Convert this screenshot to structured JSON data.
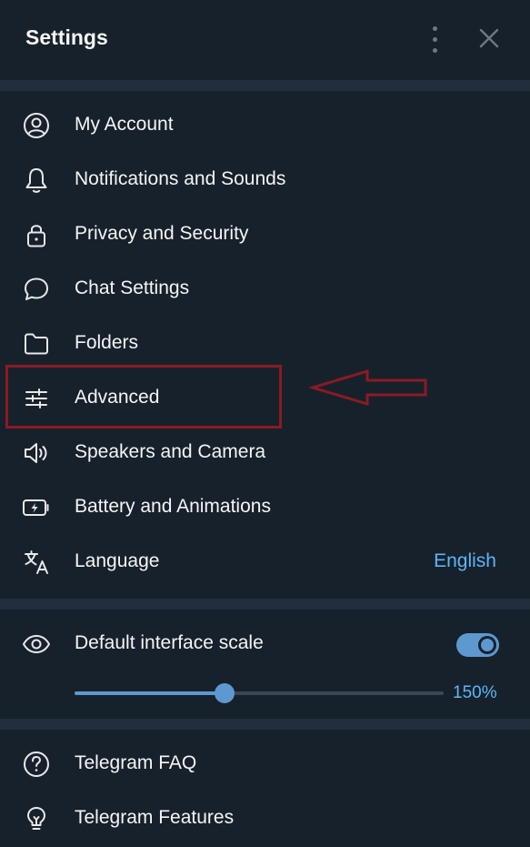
{
  "header": {
    "title": "Settings"
  },
  "menu": [
    {
      "label": "My Account",
      "icon": "account-icon"
    },
    {
      "label": "Notifications and Sounds",
      "icon": "bell-icon"
    },
    {
      "label": "Privacy and Security",
      "icon": "lock-icon"
    },
    {
      "label": "Chat Settings",
      "icon": "chat-bubble-icon"
    },
    {
      "label": "Folders",
      "icon": "folder-icon"
    },
    {
      "label": "Advanced",
      "icon": "sliders-icon"
    },
    {
      "label": "Speakers and Camera",
      "icon": "speaker-icon"
    },
    {
      "label": "Battery and Animations",
      "icon": "battery-icon"
    },
    {
      "label": "Language",
      "icon": "translate-icon",
      "value": "English"
    }
  ],
  "scale": {
    "label": "Default interface scale",
    "icon": "eye-icon",
    "toggle_on": true,
    "slider_value": "150%",
    "slider_fraction": 0.406
  },
  "help": [
    {
      "label": "Telegram FAQ",
      "icon": "question-icon"
    },
    {
      "label": "Telegram Features",
      "icon": "lightbulb-icon"
    }
  ],
  "colors": {
    "background": "#17212b",
    "divider": "#232e3c",
    "accent": "#5e98d0",
    "link": "#5eb5f7",
    "annotation": "#8b1a24"
  }
}
